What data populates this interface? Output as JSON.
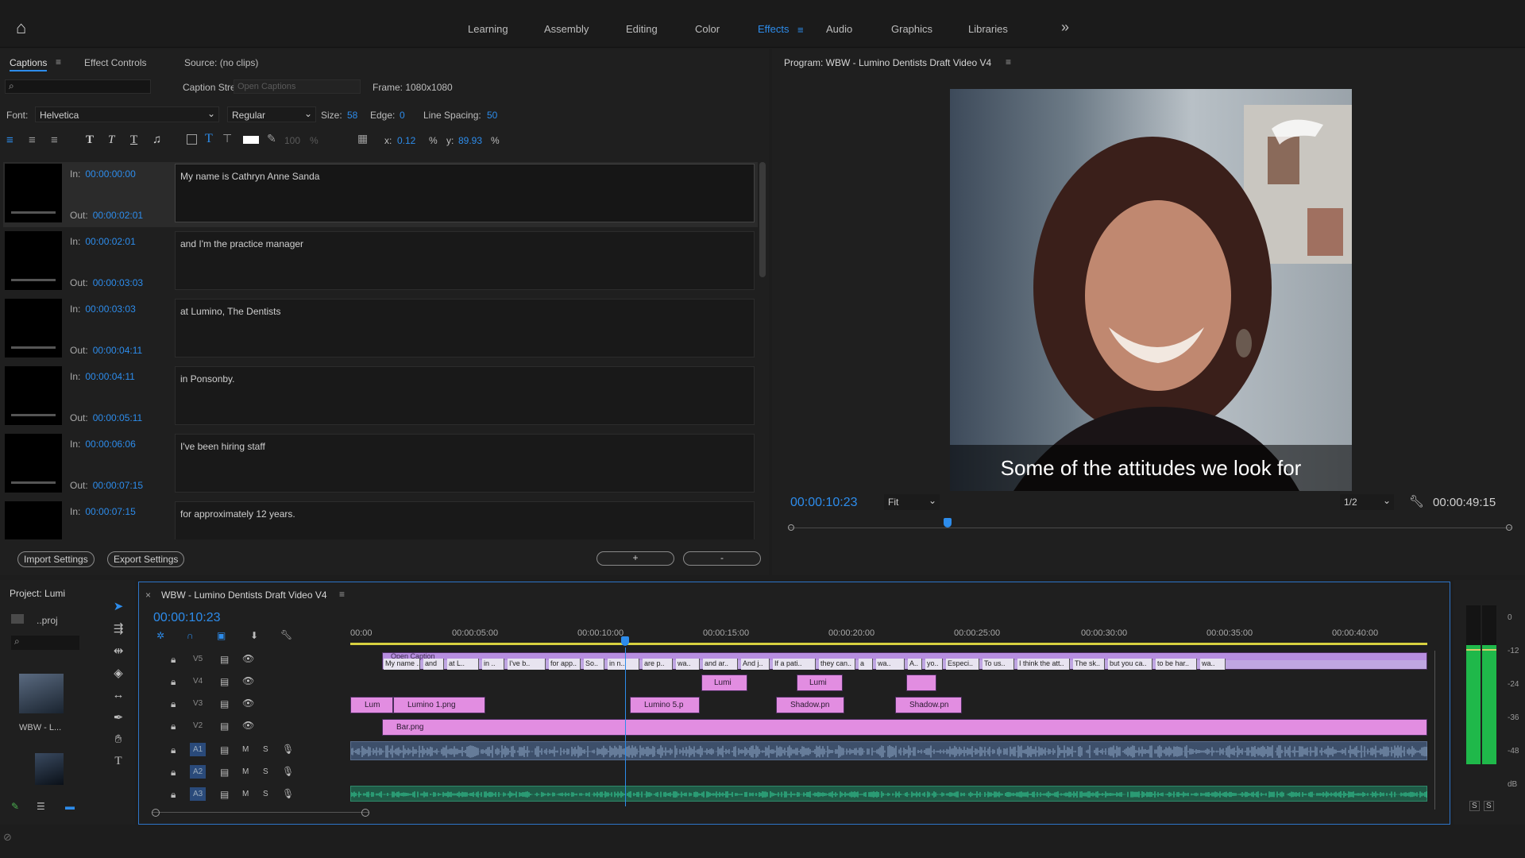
{
  "workspaces": {
    "home": "⌂",
    "tabs": [
      "Learning",
      "Assembly",
      "Editing",
      "Color",
      "Effects",
      "Audio",
      "Graphics",
      "Libraries"
    ],
    "active": "Effects",
    "more": "»"
  },
  "captions_panel": {
    "tabs": [
      "Captions",
      "Effect Controls",
      "Source: (no clips)"
    ],
    "caption_stream_label": "Caption Stream:",
    "caption_stream_value": "Open Captions",
    "frame": "Frame: 1080x1080",
    "font_label": "Font:",
    "font_value": "Helvetica",
    "style_value": "Regular",
    "size_label": "Size:",
    "size_value": "58",
    "edge_label": "Edge:",
    "edge_value": "0",
    "line_spacing_label": "Line Spacing:",
    "line_spacing_value": "50",
    "opacity_value": "100",
    "pct": "%",
    "x_label": "x:",
    "x_value": "0.12",
    "y_label": "y:",
    "y_value": "89.93",
    "in_label": "In:",
    "out_label": "Out:",
    "rows": [
      {
        "in": "00:00:00:00",
        "out": "00:00:02:01",
        "text": "My name is Cathryn Anne Sanda"
      },
      {
        "in": "00:00:02:01",
        "out": "00:00:03:03",
        "text": "and I'm the practice manager"
      },
      {
        "in": "00:00:03:03",
        "out": "00:00:04:11",
        "text": "at Lumino, The Dentists"
      },
      {
        "in": "00:00:04:11",
        "out": "00:00:05:11",
        "text": "in Ponsonby."
      },
      {
        "in": "00:00:06:06",
        "out": "00:00:07:15",
        "text": "I've been hiring staff"
      },
      {
        "in": "00:00:07:15",
        "out": "",
        "text": "for approximately 12 years."
      }
    ],
    "import_settings": "Import Settings",
    "export_settings": "Export Settings",
    "add": "+",
    "remove": "-"
  },
  "program": {
    "title": "Program: WBW - Lumino Dentists Draft Video V4",
    "caption_overlay": "Some of the attitudes we look for",
    "timecode": "00:00:10:23",
    "fit": "Fit",
    "resolution": "1/2",
    "duration": "00:00:49:15"
  },
  "project": {
    "title": "Project: Lumi",
    "file": "..proj",
    "item_label": "WBW - L..."
  },
  "timeline": {
    "title": "WBW - Lumino Dentists Draft Video V4",
    "timecode": "00:00:10:23",
    "ruler": [
      "00:00",
      "00:00:05:00",
      "00:00:10:00",
      "00:00:15:00",
      "00:00:20:00",
      "00:00:25:00",
      "00:00:30:00",
      "00:00:35:00",
      "00:00:40:00"
    ],
    "tracks": [
      "V5",
      "V4",
      "V3",
      "V2",
      "A1",
      "A2",
      "A3"
    ],
    "audio_m": "M",
    "audio_s": "S",
    "v5_first": "Open Caption",
    "v5_clips": [
      "My name ..",
      "and",
      "at L..",
      "in ..",
      "I've b..",
      "for app..",
      "So..",
      "in n..",
      "are p..",
      "wa..",
      "and ar..",
      "And j..",
      "If a pati..",
      "they can..",
      "a",
      "wa..",
      "A..",
      "yo..",
      "Especi..",
      "To us..",
      "I think the att..",
      "The sk..",
      "but you ca..",
      "to be har..",
      "wa.."
    ],
    "v4_clips": [
      "Lumi",
      "Lumi",
      ""
    ],
    "v3_clips": [
      "Lum",
      "Lumino 1.png",
      "Lumino 5.p",
      "Shadow.pn",
      "Shadow.pn"
    ],
    "v2_clip": "Bar.png"
  },
  "meter": {
    "labels": [
      "0",
      "-12",
      "-24",
      "-36",
      "-48",
      "dB"
    ],
    "solo": [
      "S",
      "S"
    ]
  }
}
